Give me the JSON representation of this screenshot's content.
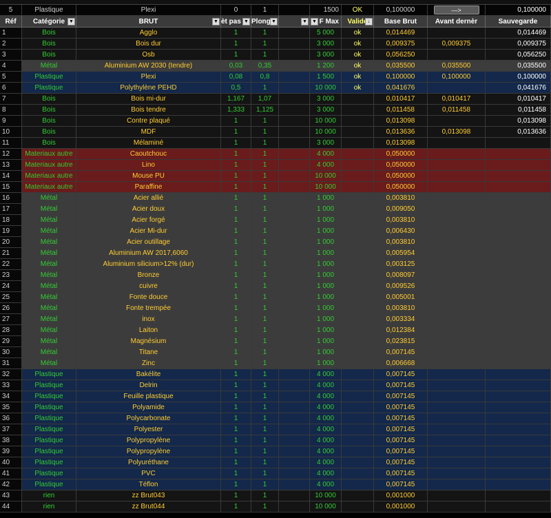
{
  "top_row": {
    "ref": "5",
    "categorie": "Plastique",
    "brut": "Plexi",
    "ep": "0",
    "plong": "1",
    "fmax": "1500",
    "valide": "OK",
    "base_brut": "0,100000",
    "button_label": "—>",
    "sauvegarde": "0,100000"
  },
  "headers": {
    "ref": "Réf",
    "categorie": "Catégorie",
    "brut": "BRUT",
    "ep": "èt pas",
    "plong": "Plong",
    "blank": "",
    "fmax": "F Max",
    "valide": "Validé",
    "base_brut": "Base Brut",
    "avant": "Avant dernèr",
    "sauvegarde": "Sauvegarde"
  },
  "colors": {
    "green": "#33cc33",
    "amber": "#ffcc33",
    "yellow": "#ffff66",
    "blue_row": "#13284a",
    "red_row": "#6a1b1b",
    "grey_row": "#3c3c3c"
  },
  "rows": [
    {
      "ref": "1",
      "cat": "Bois",
      "brut": "Agglo",
      "ep": "1",
      "pl": "1",
      "fmax": "5 000",
      "ok": "ok",
      "base": "0,014469",
      "avant": "",
      "sauv": "0,014469",
      "bg": "dark"
    },
    {
      "ref": "2",
      "cat": "Bois",
      "brut": "Bois dur",
      "ep": "1",
      "pl": "1",
      "fmax": "3 000",
      "ok": "ok",
      "base": "0,009375",
      "avant": "0,009375",
      "sauv": "0,009375",
      "bg": "dark"
    },
    {
      "ref": "3",
      "cat": "Bois",
      "brut": "Osb",
      "ep": "1",
      "pl": "1",
      "fmax": "3 000",
      "ok": "ok",
      "base": "0,056250",
      "avant": "",
      "sauv": "0,056250",
      "bg": "dark"
    },
    {
      "ref": "4",
      "cat": "Métal",
      "brut": "Aluminium AW 2030 (tendre)",
      "ep": "0,03",
      "pl": "0,35",
      "fmax": "1 200",
      "ok": "ok",
      "base": "0,035500",
      "avant": "0,035500",
      "sauv": "0,035500",
      "bg": "grey"
    },
    {
      "ref": "5",
      "cat": "Plastique",
      "brut": "Plexi",
      "ep": "0,08",
      "pl": "0,8",
      "fmax": "1 500",
      "ok": "ok",
      "base": "0,100000",
      "avant": "0,100000",
      "sauv": "0,100000",
      "bg": "blue"
    },
    {
      "ref": "6",
      "cat": "Plastique",
      "brut": "Polythylène PEHD",
      "ep": "0,5",
      "pl": "1",
      "fmax": "10 000",
      "ok": "ok",
      "base": "0,041676",
      "avant": "",
      "sauv": "0,041676",
      "bg": "blue"
    },
    {
      "ref": "7",
      "cat": "Bois",
      "brut": "Bois mi-dur",
      "ep": "1,167",
      "pl": "1,07",
      "fmax": "3 000",
      "ok": "",
      "base": "0,010417",
      "avant": "0,010417",
      "sauv": "0,010417",
      "bg": "dark"
    },
    {
      "ref": "8",
      "cat": "Bois",
      "brut": "Bois tendre",
      "ep": "1,333",
      "pl": "1,125",
      "fmax": "3 000",
      "ok": "",
      "base": "0,011458",
      "avant": "0,011458",
      "sauv": "0,011458",
      "bg": "dark"
    },
    {
      "ref": "9",
      "cat": "Bois",
      "brut": "Contre plaqué",
      "ep": "1",
      "pl": "1",
      "fmax": "10 000",
      "ok": "",
      "base": "0,013098",
      "avant": "",
      "sauv": "0,013098",
      "bg": "dark"
    },
    {
      "ref": "10",
      "cat": "Bois",
      "brut": "MDF",
      "ep": "1",
      "pl": "1",
      "fmax": "10 000",
      "ok": "",
      "base": "0,013636",
      "avant": "0,013098",
      "sauv": "0,013636",
      "bg": "dark"
    },
    {
      "ref": "11",
      "cat": "Bois",
      "brut": "Mélaminé",
      "ep": "1",
      "pl": "1",
      "fmax": "3 000",
      "ok": "",
      "base": "0,013098",
      "avant": "",
      "sauv": "",
      "bg": "dark"
    },
    {
      "ref": "12",
      "cat": "Materiaux autre",
      "brut": "Caoutchouc",
      "ep": "1",
      "pl": "1",
      "fmax": "4 000",
      "ok": "",
      "base": "0,050000",
      "avant": "",
      "sauv": "",
      "bg": "red"
    },
    {
      "ref": "13",
      "cat": "Materiaux autre",
      "brut": "Lino",
      "ep": "1",
      "pl": "1",
      "fmax": "4 000",
      "ok": "",
      "base": "0,050000",
      "avant": "",
      "sauv": "",
      "bg": "red"
    },
    {
      "ref": "14",
      "cat": "Materiaux autre",
      "brut": "Mouse PU",
      "ep": "1",
      "pl": "1",
      "fmax": "10 000",
      "ok": "",
      "base": "0,050000",
      "avant": "",
      "sauv": "",
      "bg": "red"
    },
    {
      "ref": "15",
      "cat": "Materiaux autre",
      "brut": "Paraffine",
      "ep": "1",
      "pl": "1",
      "fmax": "10 000",
      "ok": "",
      "base": "0,050000",
      "avant": "",
      "sauv": "",
      "bg": "red"
    },
    {
      "ref": "16",
      "cat": "Métal",
      "brut": "Acier allié",
      "ep": "1",
      "pl": "1",
      "fmax": "1 000",
      "ok": "",
      "base": "0,003810",
      "avant": "",
      "sauv": "",
      "bg": "grey"
    },
    {
      "ref": "17",
      "cat": "Métal",
      "brut": "Acier doux",
      "ep": "1",
      "pl": "1",
      "fmax": "1 000",
      "ok": "",
      "base": "0,009050",
      "avant": "",
      "sauv": "",
      "bg": "grey"
    },
    {
      "ref": "18",
      "cat": "Métal",
      "brut": "Acier forgé",
      "ep": "1",
      "pl": "1",
      "fmax": "1 000",
      "ok": "",
      "base": "0,003810",
      "avant": "",
      "sauv": "",
      "bg": "grey"
    },
    {
      "ref": "19",
      "cat": "Métal",
      "brut": "Acier Mi-dur",
      "ep": "1",
      "pl": "1",
      "fmax": "1 000",
      "ok": "",
      "base": "0,006430",
      "avant": "",
      "sauv": "",
      "bg": "grey"
    },
    {
      "ref": "20",
      "cat": "Métal",
      "brut": "Acier outillage",
      "ep": "1",
      "pl": "1",
      "fmax": "1 000",
      "ok": "",
      "base": "0,003810",
      "avant": "",
      "sauv": "",
      "bg": "grey"
    },
    {
      "ref": "21",
      "cat": "Métal",
      "brut": "Aluminium AW 2017,6060",
      "ep": "1",
      "pl": "1",
      "fmax": "1 000",
      "ok": "",
      "base": "0,005954",
      "avant": "",
      "sauv": "",
      "bg": "grey"
    },
    {
      "ref": "22",
      "cat": "Métal",
      "brut": "Aluminium silicium>12% (dur)",
      "ep": "1",
      "pl": "1",
      "fmax": "1 000",
      "ok": "",
      "base": "0,003125",
      "avant": "",
      "sauv": "",
      "bg": "grey"
    },
    {
      "ref": "23",
      "cat": "Métal",
      "brut": "Bronze",
      "ep": "1",
      "pl": "1",
      "fmax": "1 000",
      "ok": "",
      "base": "0,008097",
      "avant": "",
      "sauv": "",
      "bg": "grey"
    },
    {
      "ref": "24",
      "cat": "Métal",
      "brut": "cuivre",
      "ep": "1",
      "pl": "1",
      "fmax": "1 000",
      "ok": "",
      "base": "0,009526",
      "avant": "",
      "sauv": "",
      "bg": "grey"
    },
    {
      "ref": "25",
      "cat": "Métal",
      "brut": "Fonte douce",
      "ep": "1",
      "pl": "1",
      "fmax": "1 000",
      "ok": "",
      "base": "0,005001",
      "avant": "",
      "sauv": "",
      "bg": "grey"
    },
    {
      "ref": "26",
      "cat": "Métal",
      "brut": "Fonte trempée",
      "ep": "1",
      "pl": "1",
      "fmax": "1 000",
      "ok": "",
      "base": "0,003810",
      "avant": "",
      "sauv": "",
      "bg": "grey"
    },
    {
      "ref": "27",
      "cat": "Métal",
      "brut": "inox",
      "ep": "1",
      "pl": "1",
      "fmax": "1 000",
      "ok": "",
      "base": "0,003334",
      "avant": "",
      "sauv": "",
      "bg": "grey"
    },
    {
      "ref": "28",
      "cat": "Métal",
      "brut": "Laiton",
      "ep": "1",
      "pl": "1",
      "fmax": "1 000",
      "ok": "",
      "base": "0,012384",
      "avant": "",
      "sauv": "",
      "bg": "grey"
    },
    {
      "ref": "29",
      "cat": "Métal",
      "brut": "Magnésium",
      "ep": "1",
      "pl": "1",
      "fmax": "1 000",
      "ok": "",
      "base": "0,023815",
      "avant": "",
      "sauv": "",
      "bg": "grey"
    },
    {
      "ref": "30",
      "cat": "Métal",
      "brut": "Titane",
      "ep": "1",
      "pl": "1",
      "fmax": "1 000",
      "ok": "",
      "base": "0,007145",
      "avant": "",
      "sauv": "",
      "bg": "grey"
    },
    {
      "ref": "31",
      "cat": "Métal",
      "brut": "Zinc",
      "ep": "1",
      "pl": "1",
      "fmax": "1 000",
      "ok": "",
      "base": "0,006668",
      "avant": "",
      "sauv": "",
      "bg": "grey"
    },
    {
      "ref": "32",
      "cat": "Plastique",
      "brut": "Bakélite",
      "ep": "1",
      "pl": "1",
      "fmax": "4 000",
      "ok": "",
      "base": "0,007145",
      "avant": "",
      "sauv": "",
      "bg": "blue"
    },
    {
      "ref": "33",
      "cat": "Plastique",
      "brut": "Delrin",
      "ep": "1",
      "pl": "1",
      "fmax": "4 000",
      "ok": "",
      "base": "0,007145",
      "avant": "",
      "sauv": "",
      "bg": "blue"
    },
    {
      "ref": "34",
      "cat": "Plastique",
      "brut": "Feuille plastique",
      "ep": "1",
      "pl": "1",
      "fmax": "4 000",
      "ok": "",
      "base": "0,007145",
      "avant": "",
      "sauv": "",
      "bg": "blue"
    },
    {
      "ref": "35",
      "cat": "Plastique",
      "brut": "Polyamide",
      "ep": "1",
      "pl": "1",
      "fmax": "4 000",
      "ok": "",
      "base": "0,007145",
      "avant": "",
      "sauv": "",
      "bg": "blue"
    },
    {
      "ref": "36",
      "cat": "Plastique",
      "brut": "Polycarbonate",
      "ep": "1",
      "pl": "1",
      "fmax": "4 000",
      "ok": "",
      "base": "0,007145",
      "avant": "",
      "sauv": "",
      "bg": "blue"
    },
    {
      "ref": "37",
      "cat": "Plastique",
      "brut": "Polyester",
      "ep": "1",
      "pl": "1",
      "fmax": "4 000",
      "ok": "",
      "base": "0,007145",
      "avant": "",
      "sauv": "",
      "bg": "blue"
    },
    {
      "ref": "38",
      "cat": "Plastique",
      "brut": "Polypropylène",
      "ep": "1",
      "pl": "1",
      "fmax": "4 000",
      "ok": "",
      "base": "0,007145",
      "avant": "",
      "sauv": "",
      "bg": "blue"
    },
    {
      "ref": "39",
      "cat": "Plastique",
      "brut": "Polypropylène",
      "ep": "1",
      "pl": "1",
      "fmax": "4 000",
      "ok": "",
      "base": "0,007145",
      "avant": "",
      "sauv": "",
      "bg": "blue"
    },
    {
      "ref": "40",
      "cat": "Plastique",
      "brut": "Polyuréthane",
      "ep": "1",
      "pl": "1",
      "fmax": "4 000",
      "ok": "",
      "base": "0,007145",
      "avant": "",
      "sauv": "",
      "bg": "blue"
    },
    {
      "ref": "41",
      "cat": "Plastique",
      "brut": "PVC",
      "ep": "1",
      "pl": "1",
      "fmax": "4 000",
      "ok": "",
      "base": "0,007145",
      "avant": "",
      "sauv": "",
      "bg": "blue"
    },
    {
      "ref": "42",
      "cat": "Plastique",
      "brut": "Téflon",
      "ep": "1",
      "pl": "1",
      "fmax": "4 000",
      "ok": "",
      "base": "0,007145",
      "avant": "",
      "sauv": "",
      "bg": "blue"
    },
    {
      "ref": "43",
      "cat": "rien",
      "brut": "zz Brut043",
      "ep": "1",
      "pl": "1",
      "fmax": "10 000",
      "ok": "",
      "base": "0,001000",
      "avant": "",
      "sauv": "",
      "bg": "dark"
    },
    {
      "ref": "44",
      "cat": "rien",
      "brut": "zz Brut044",
      "ep": "1",
      "pl": "1",
      "fmax": "10 000",
      "ok": "",
      "base": "0,001000",
      "avant": "",
      "sauv": "",
      "bg": "dark"
    }
  ]
}
